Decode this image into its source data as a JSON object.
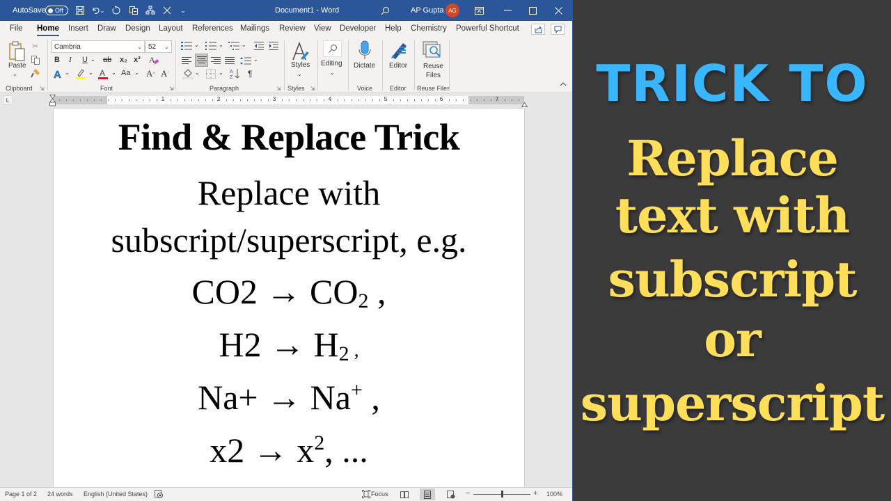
{
  "titlebar": {
    "autosave_label": "AutoSave",
    "autosave_state": "Off",
    "quick_access": [
      {
        "name": "save-icon",
        "glyph": "💾"
      },
      {
        "name": "undo-icon",
        "glyph": "↶"
      },
      {
        "name": "redo-icon",
        "glyph": "↻"
      },
      {
        "name": "copy-format-icon",
        "glyph": "⧉"
      },
      {
        "name": "org-chart-icon",
        "glyph": "品"
      },
      {
        "name": "close-doc-icon",
        "glyph": "✕"
      },
      {
        "name": "customize-qat-icon",
        "glyph": "⌄"
      }
    ],
    "doc_title": "Document1  -  Word",
    "user_name": "AP Gupta",
    "user_initials": "AG",
    "ribbon_display_glyph": "⊡",
    "minimize_glyph": "—",
    "maximize_glyph": "☐",
    "close_glyph": "✕",
    "search_glyph": "⚲"
  },
  "tabs": [
    {
      "label": "File",
      "active": false
    },
    {
      "label": "Home",
      "active": true
    },
    {
      "label": "Insert",
      "active": false
    },
    {
      "label": "Draw",
      "active": false
    },
    {
      "label": "Design",
      "active": false
    },
    {
      "label": "Layout",
      "active": false
    },
    {
      "label": "References",
      "active": false
    },
    {
      "label": "Mailings",
      "active": false
    },
    {
      "label": "Review",
      "active": false
    },
    {
      "label": "View",
      "active": false
    },
    {
      "label": "Developer",
      "active": false
    },
    {
      "label": "Help",
      "active": false
    },
    {
      "label": "Chemistry",
      "active": false
    },
    {
      "label": "Powerful Shortcut",
      "active": false
    }
  ],
  "tab_icons": {
    "share": "⇪",
    "comments": "💬"
  },
  "ribbon": {
    "clipboard": {
      "label": "Clipboard",
      "paste_label": "Paste"
    },
    "font": {
      "label": "Font",
      "font_name": "Cambria",
      "font_size": "52",
      "bold": "B",
      "italic": "I",
      "underline": "U",
      "strike": "ab",
      "subscript": "x₂",
      "superscript": "x²",
      "text_effects": "A",
      "highlight": "✎",
      "font_color": "A",
      "change_case": "Aa",
      "grow": "A^",
      "shrink": "Aˇ",
      "clear": "A"
    },
    "paragraph": {
      "label": "Paragraph",
      "pilcrow": "¶",
      "sort": "A↓"
    },
    "styles": {
      "label": "Styles",
      "button": "Styles"
    },
    "editing": {
      "button": "Editing"
    },
    "voice": {
      "label": "Voice",
      "button": "Dictate"
    },
    "editor": {
      "label": "Editor",
      "button": "Editor"
    },
    "reuse": {
      "label": "Reuse Files",
      "button_line1": "Reuse",
      "button_line2": "Files"
    },
    "collapse_glyph": "︿"
  },
  "ruler": {
    "numbers": [
      "1",
      "2",
      "3",
      "4",
      "5",
      "6",
      "7"
    ],
    "tab_selector": "L"
  },
  "document": {
    "title": "Find & Replace Trick",
    "line1": "Replace with",
    "line2": "subscript/superscript, e.g.",
    "examples": [
      {
        "from": "CO2",
        "arrow": "→",
        "base": "CO",
        "script": "2",
        "kind": "sub",
        "suffix": " ,"
      },
      {
        "from": "H2",
        "arrow": "→",
        "base": "H",
        "script": "2",
        "kind": "sub",
        "suffix": " ,"
      },
      {
        "from": "Na+",
        "arrow": "→",
        "base": "Na",
        "script": "+",
        "kind": "sup",
        "suffix": " ,"
      },
      {
        "from": "x2",
        "arrow": "→",
        "base": "x",
        "script": "2",
        "kind": "sup",
        "suffix": ", ..."
      }
    ]
  },
  "statusbar": {
    "page": "Page 1 of 2",
    "words": "24 words",
    "language": "English (United States)",
    "focus": "Focus",
    "zoom_minus": "−",
    "zoom_plus": "+",
    "zoom_level": "100%",
    "zoom_percent": 100
  },
  "promo": {
    "heading": "TRICK TO",
    "lines": [
      "Replace",
      "text with",
      "subscript",
      "or",
      "superscript"
    ],
    "heading_color": "#38b6ff",
    "text_color": "#ffde59"
  }
}
